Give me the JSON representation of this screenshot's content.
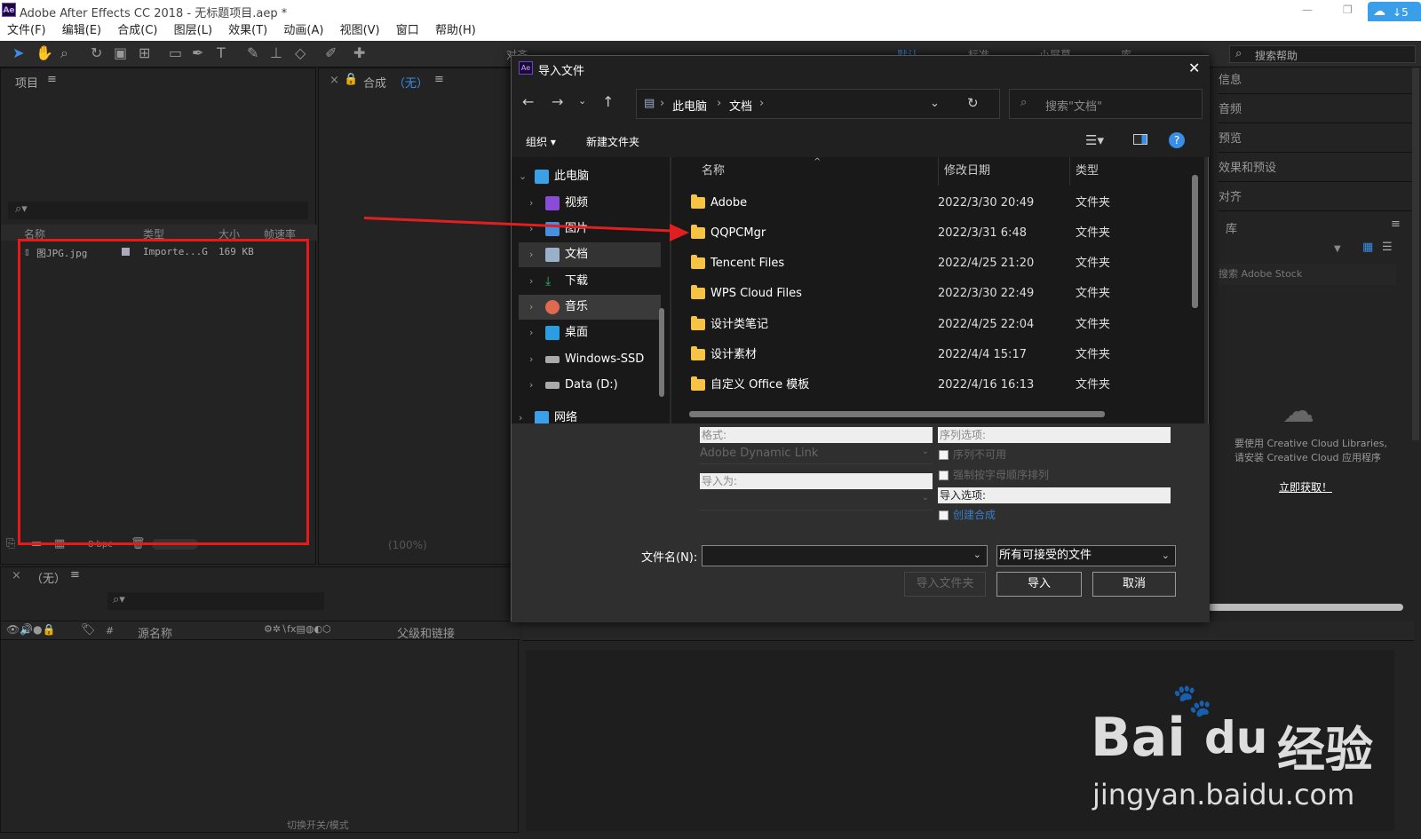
{
  "window": {
    "app_badge": "Ae",
    "title": "Adobe After Effects CC 2018 - 无标题项目.aep *",
    "cc_badge": "5"
  },
  "menu": [
    "文件(F)",
    "编辑(E)",
    "合成(C)",
    "图层(L)",
    "效果(T)",
    "动画(A)",
    "视图(V)",
    "窗口",
    "帮助(H)"
  ],
  "toolbar": {
    "tabs": [
      "对齐",
      "默认",
      "标准",
      "小屏幕",
      "库"
    ],
    "search_placeholder": "搜索帮助"
  },
  "project_panel": {
    "title": "项目",
    "columns": [
      "名称",
      "类型",
      "大小",
      "帧速率"
    ],
    "items": [
      {
        "name": "图JPG.jpg",
        "type": "Importe...G",
        "size": "169 KB"
      }
    ],
    "bpc": "8 bpc"
  },
  "comp_panel": {
    "title": "合成",
    "name": "（无）",
    "zoom": "(100%)"
  },
  "timeline": {
    "title": "（无）",
    "columns": [
      "源名称",
      "父级和链接"
    ],
    "hash": "#",
    "footer": "切换开关/模式"
  },
  "right_panels": [
    "信息",
    "音频",
    "预览",
    "效果和预设",
    "对齐",
    "库"
  ],
  "library": {
    "stock_placeholder": "搜索 Adobe Stock",
    "message_line1": "要使用 Creative Cloud Libraries,",
    "message_line2": "请安装 Creative Cloud 应用程序",
    "link": "立即获取！"
  },
  "dialog": {
    "title": "导入文件",
    "breadcrumb": [
      "此电脑",
      "文档"
    ],
    "search_placeholder": "搜索\"文档\"",
    "organize": "组织",
    "new_folder": "新建文件夹",
    "tree": [
      {
        "label": "此电脑",
        "icon": "pc-icon",
        "color": "#3aa0e8"
      },
      {
        "label": "视频",
        "icon": "video-icon",
        "color": "#8a4cd6"
      },
      {
        "label": "图片",
        "icon": "pictures-icon",
        "color": "#4a8ee0"
      },
      {
        "label": "文档",
        "icon": "documents-icon",
        "color": "#9ab0c8"
      },
      {
        "label": "下载",
        "icon": "download-icon",
        "color": "#2fb86a"
      },
      {
        "label": "音乐",
        "icon": "music-icon",
        "color": "#e06a50"
      },
      {
        "label": "桌面",
        "icon": "desktop-icon",
        "color": "#2a9ee0"
      },
      {
        "label": "Windows-SSD",
        "icon": "drive-icon",
        "color": "#aaaaaa"
      },
      {
        "label": "Data (D:)",
        "icon": "drive-icon",
        "color": "#aaaaaa"
      },
      {
        "label": "网络",
        "icon": "network-icon",
        "color": "#3aa0e8"
      }
    ],
    "columns": {
      "name": "名称",
      "date": "修改日期",
      "type": "类型"
    },
    "files": [
      {
        "name": "Adobe",
        "date": "2022/3/30 20:49",
        "type": "文件夹"
      },
      {
        "name": "QQPCMgr",
        "date": "2022/3/31 6:48",
        "type": "文件夹"
      },
      {
        "name": "Tencent Files",
        "date": "2022/4/25 21:20",
        "type": "文件夹"
      },
      {
        "name": "WPS Cloud Files",
        "date": "2022/3/30 22:49",
        "type": "文件夹"
      },
      {
        "name": "设计类笔记",
        "date": "2022/4/25 22:04",
        "type": "文件夹"
      },
      {
        "name": "设计素材",
        "date": "2022/4/4 15:17",
        "type": "文件夹"
      },
      {
        "name": "自定义 Office 模板",
        "date": "2022/4/16 16:13",
        "type": "文件夹"
      }
    ],
    "format_label": "格式:",
    "format_value": "Adobe Dynamic Link",
    "import_as_label": "导入为:",
    "sequence_label": "序列选项:",
    "sequence_unavailable": "序列不可用",
    "force_alpha": "强制按字母顺序排列",
    "import_options": "导入选项:",
    "create_comp": "创建合成",
    "filename_label": "文件名(N):",
    "filter": "所有可接受的文件",
    "import_folder": "导入文件夹",
    "import_btn": "导入",
    "cancel_btn": "取消"
  },
  "watermark": {
    "brand_a": "Bai",
    "brand_b": "du",
    "brand_c": "经验",
    "url": "jingyan.baidu.com"
  }
}
